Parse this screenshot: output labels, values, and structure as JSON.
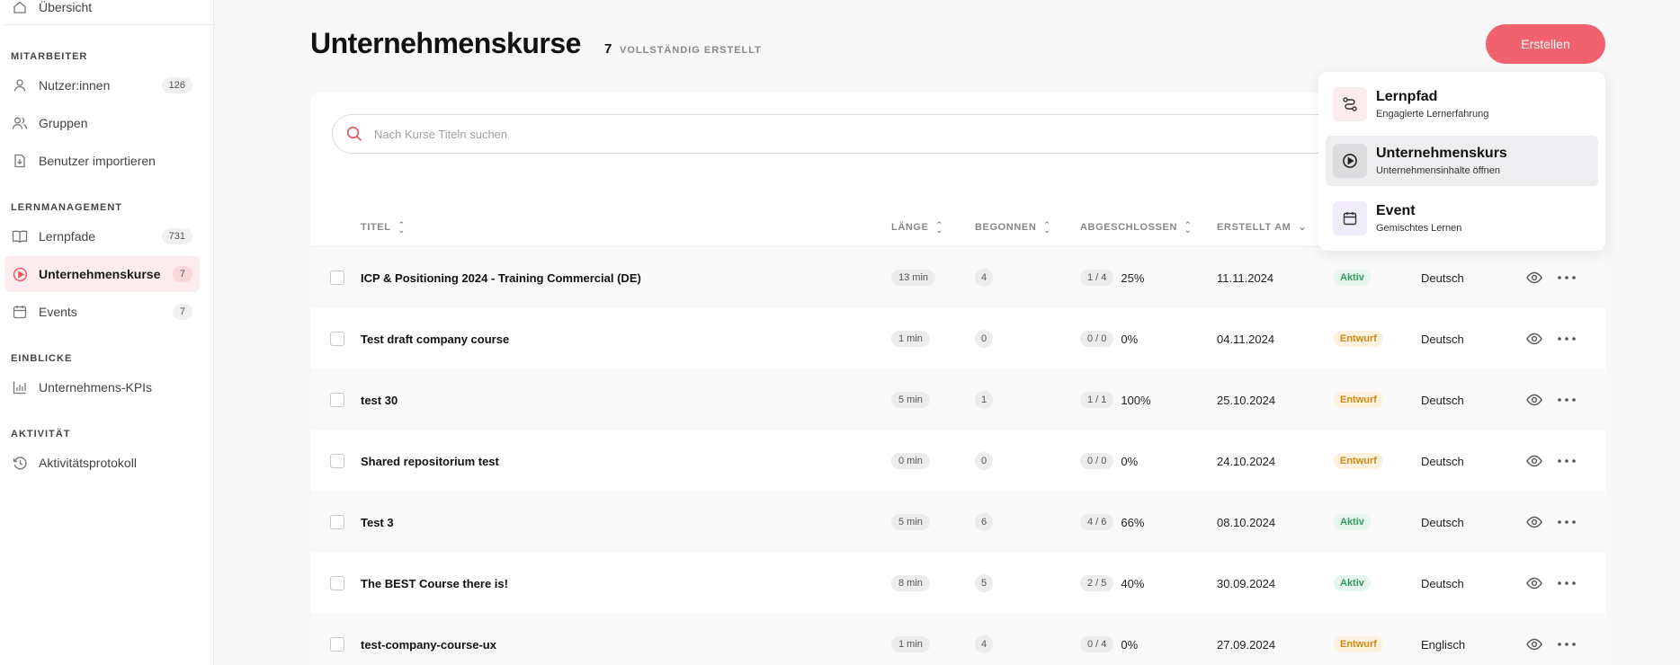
{
  "sidebar": {
    "top_item": {
      "label": "Übersicht",
      "icon": "home-icon"
    },
    "sections": [
      {
        "title": "MITARBEITER"
      },
      {
        "title": "LERNMANAGEMENT"
      },
      {
        "title": "EINBLICKE"
      },
      {
        "title": "AKTIVITÄT"
      }
    ],
    "items": [
      {
        "label": "Nutzer:innen",
        "count": "126",
        "icon": "user-icon"
      },
      {
        "label": "Gruppen",
        "count": "",
        "icon": "users-icon"
      },
      {
        "label": "Benutzer importieren",
        "count": "",
        "icon": "import-icon"
      },
      {
        "label": "Lernpfade",
        "count": "731",
        "icon": "book-icon"
      },
      {
        "label": "Unternehmenskurse",
        "count": "7",
        "icon": "play-circle-icon",
        "active": true
      },
      {
        "label": "Events",
        "count": "7",
        "icon": "calendar-icon"
      },
      {
        "label": "Unternehmens-KPIs",
        "count": "",
        "icon": "bar-chart-icon"
      },
      {
        "label": "Aktivitätsprotokoll",
        "count": "",
        "icon": "history-icon"
      }
    ]
  },
  "header": {
    "title": "Unternehmenskurse",
    "count": "7",
    "count_label": "VOLLSTÄNDIG ERSTELLT",
    "create_label": "Erstellen"
  },
  "search": {
    "placeholder": "Nach Kurse Titeln suchen"
  },
  "table": {
    "columns": {
      "title": "TITEL",
      "length": "LÄNGE",
      "started": "BEGONNEN",
      "completed": "ABGESCHLOSSEN",
      "created": "ERSTELLT AM"
    },
    "rows": [
      {
        "title": "ICP & Positioning 2024 - Training Commercial (DE)",
        "length": "13 min",
        "started": "4",
        "ratio": "1 / 4",
        "percent": "25%",
        "created": "11.11.2024",
        "status": "Aktiv",
        "language": "Deutsch"
      },
      {
        "title": "Test draft company course",
        "length": "1 min",
        "started": "0",
        "ratio": "0 / 0",
        "percent": "0%",
        "created": "04.11.2024",
        "status": "Entwurf",
        "language": "Deutsch"
      },
      {
        "title": "test 30",
        "length": "5 min",
        "started": "1",
        "ratio": "1 / 1",
        "percent": "100%",
        "created": "25.10.2024",
        "status": "Entwurf",
        "language": "Deutsch"
      },
      {
        "title": "Shared repositorium test",
        "length": "0 min",
        "started": "0",
        "ratio": "0 / 0",
        "percent": "0%",
        "created": "24.10.2024",
        "status": "Entwurf",
        "language": "Deutsch"
      },
      {
        "title": "Test 3",
        "length": "5 min",
        "started": "6",
        "ratio": "4 / 6",
        "percent": "66%",
        "created": "08.10.2024",
        "status": "Aktiv",
        "language": "Deutsch"
      },
      {
        "title": "The BEST Course there is!",
        "length": "8 min",
        "started": "5",
        "ratio": "2 / 5",
        "percent": "40%",
        "created": "30.09.2024",
        "status": "Aktiv",
        "language": "Deutsch"
      },
      {
        "title": "test-company-course-ux",
        "length": "1 min",
        "started": "4",
        "ratio": "0 / 4",
        "percent": "0%",
        "created": "27.09.2024",
        "status": "Entwurf",
        "language": "Englisch"
      }
    ]
  },
  "dropdown": {
    "items": [
      {
        "title": "Lernpfad",
        "subtitle": "Engagierte Lernerfahrung",
        "icon": "route-icon",
        "color": "#fdecee"
      },
      {
        "title": "Unternehmenskurs",
        "subtitle": "Unternehmensinhalte öffnen",
        "icon": "play-circle-icon",
        "color": "#dcdcdf"
      },
      {
        "title": "Event",
        "subtitle": "Gemischtes Lernen",
        "icon": "calendar-icon",
        "color": "#f1ecfb"
      }
    ]
  },
  "colors": {
    "accent": "#f0636e",
    "aktiv": "#2e9c5a",
    "entwurf": "#d08a14"
  }
}
